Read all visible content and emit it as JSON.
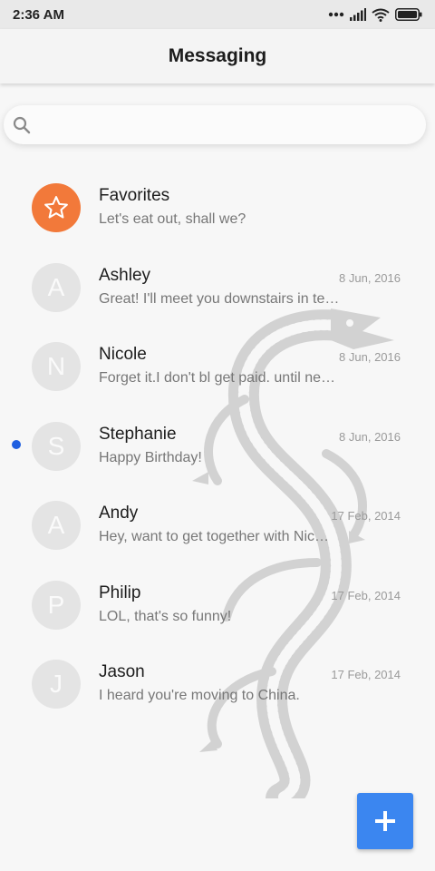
{
  "status_bar": {
    "time": "2:36 AM"
  },
  "app_bar": {
    "title": "Messaging"
  },
  "search": {
    "placeholder": "",
    "value": ""
  },
  "conversations": [
    {
      "name": "Favorites",
      "snippet": "Let's eat out, shall we?",
      "date": "",
      "avatar": "★",
      "type": "favorites",
      "unread": false
    },
    {
      "name": "Ashley",
      "snippet": "Great! I'll meet you downstairs in te…",
      "date": "8 Jun, 2016",
      "avatar": "A",
      "unread": false
    },
    {
      "name": "Nicole",
      "snippet": "Forget it.I don't bl get paid. until ne…",
      "date": "8 Jun, 2016",
      "avatar": "N",
      "unread": false
    },
    {
      "name": "Stephanie",
      "snippet": "Happy Birthday!",
      "date": "8 Jun, 2016",
      "avatar": "S",
      "unread": true
    },
    {
      "name": "Andy",
      "snippet": "Hey, want to get together with Nic…",
      "date": "17 Feb, 2014",
      "avatar": "A",
      "unread": false
    },
    {
      "name": "Philip",
      "snippet": "LOL, that's so funny!",
      "date": "17 Feb, 2014",
      "avatar": "P",
      "unread": false
    },
    {
      "name": "Jason",
      "snippet": "I heard you're moving to China.",
      "date": "17 Feb, 2014",
      "avatar": "J",
      "unread": false
    }
  ],
  "fab": {
    "icon": "plus-icon"
  },
  "colors": {
    "accent": "#3b86f0",
    "favorites_avatar": "#f2793a",
    "unread_dot": "#1f5fe0"
  }
}
